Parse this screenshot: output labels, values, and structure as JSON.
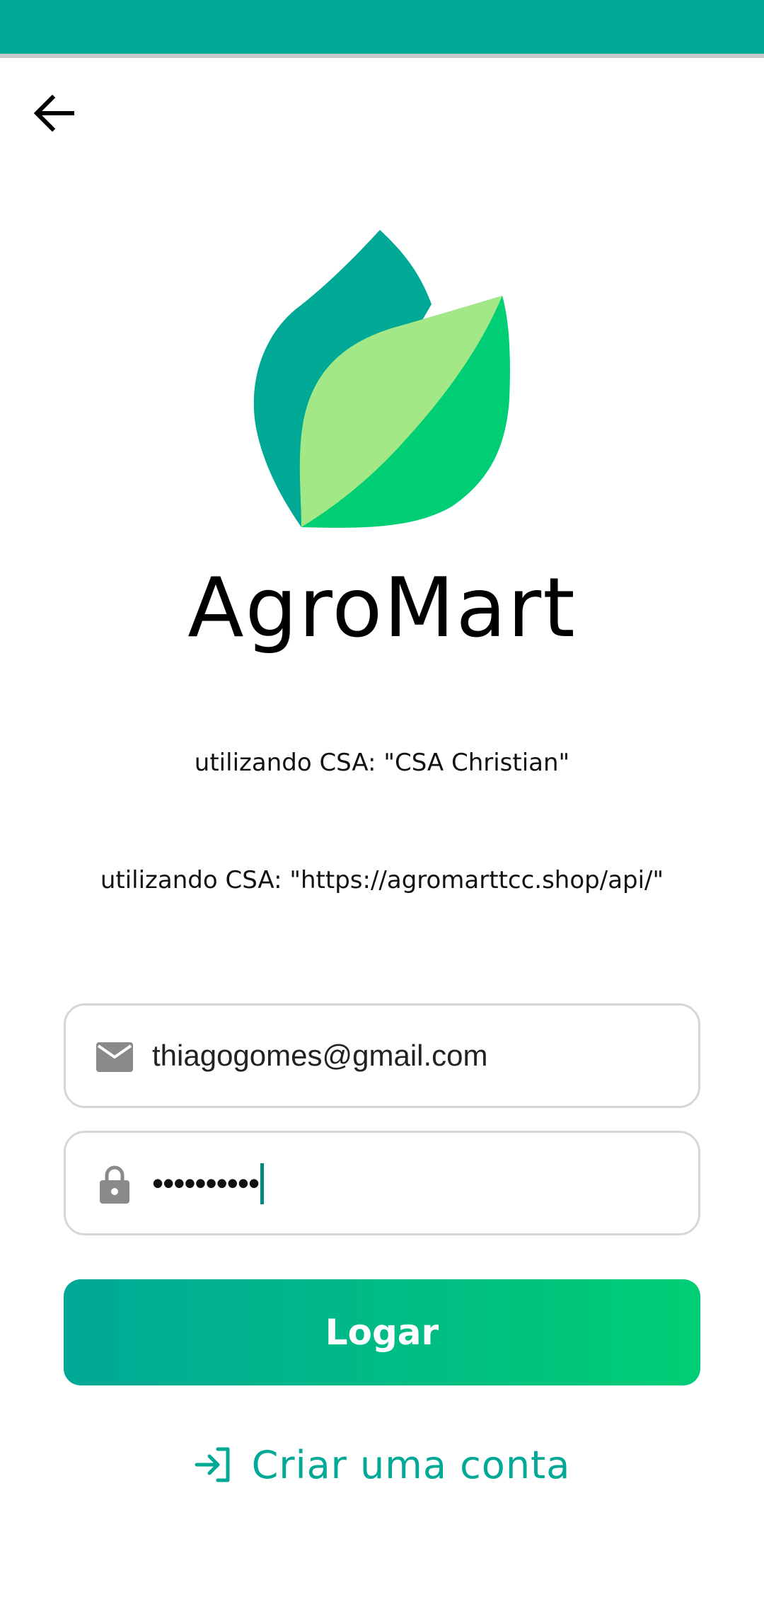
{
  "status_bar": {
    "color": "#00A896"
  },
  "header": {
    "back_icon": "arrow-left-icon"
  },
  "brand": {
    "app_name": "AgroMart",
    "logo_icon": "leaf-logo-icon",
    "colors": {
      "dark_leaf": "#00A896",
      "light_leaf": "#A3E887",
      "bright_leaf": "#00CE75"
    }
  },
  "info": {
    "line1": "utilizando CSA: \"CSA Christian\"",
    "line2": "utilizando CSA: \"https://agromarttcc.shop/api/\""
  },
  "form": {
    "email": {
      "icon": "mail-icon",
      "value": "thiagogomes@gmail.com"
    },
    "password": {
      "icon": "lock-icon",
      "value": "••••••••••"
    }
  },
  "actions": {
    "login_label": "Logar",
    "create_account_label": "Criar uma conta",
    "create_account_icon": "login-icon"
  },
  "colors": {
    "accent": "#00A896",
    "accent_end": "#00CE75"
  }
}
